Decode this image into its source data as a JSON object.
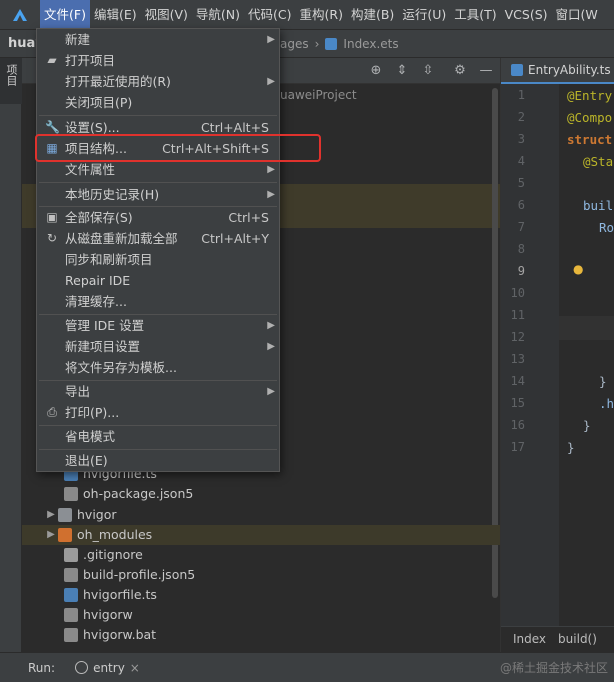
{
  "menubar": {
    "items": [
      "文件(F)",
      "编辑(E)",
      "视图(V)",
      "导航(N)",
      "代码(C)",
      "重构(R)",
      "构建(B)",
      "运行(U)",
      "工具(T)",
      "VCS(S)",
      "窗口(W"
    ]
  },
  "navbar": {
    "project": "huaw",
    "crumb_fragment": "ages",
    "crumb_file": "Index.ets"
  },
  "left_strip": {
    "project_label": "项目"
  },
  "project_panel": {
    "path_fragment": "uaweiProject",
    "tree": [
      {
        "label": "hvigorfile.ts",
        "icon": "ts-file-icon"
      },
      {
        "label": "oh-package.json5",
        "icon": "json-file-icon"
      },
      {
        "label": "hvigor",
        "icon": "folder-icon"
      },
      {
        "label": "oh_modules",
        "icon": "folder-orange-icon"
      },
      {
        "label": ".gitignore",
        "icon": "gitignore-icon"
      },
      {
        "label": "build-profile.json5",
        "icon": "json-file-icon"
      },
      {
        "label": "hvigorfile.ts",
        "icon": "ts-file-icon"
      },
      {
        "label": "hvigorw",
        "icon": "script-icon"
      },
      {
        "label": "hvigorw.bat",
        "icon": "bat-icon"
      }
    ]
  },
  "editor": {
    "tab_label": "EntryAbility.ts",
    "line_numbers": [
      "1",
      "2",
      "3",
      "4",
      "5",
      "6",
      "7",
      "8",
      "9",
      "10",
      "11",
      "12",
      "13",
      "14",
      "15",
      "16",
      "17"
    ],
    "code": {
      "l1": "@Entry",
      "l2": "@Compo",
      "l3": "struct",
      "l4": "@Sta",
      "l6": "buil",
      "l7": "Ro",
      "l14": "}",
      "l15": ".h",
      "l16": "}",
      "l17": "}"
    },
    "footer": [
      "Index",
      "build()"
    ]
  },
  "runbar": {
    "label": "Run:",
    "config": "entry",
    "close": "×"
  },
  "watermark": "@稀土掘金技术社区",
  "file_menu": {
    "items": [
      {
        "label": "新建",
        "shortcut": "",
        "submenu": true,
        "icon": ""
      },
      {
        "label": "打开项目",
        "shortcut": "",
        "submenu": false,
        "icon": "folder-open-icon"
      },
      {
        "label": "打开最近使用的(R)",
        "shortcut": "",
        "submenu": true,
        "icon": ""
      },
      {
        "label": "关闭项目(P)",
        "shortcut": "",
        "submenu": false,
        "icon": ""
      },
      {
        "label": "设置(S)...",
        "shortcut": "Ctrl+Alt+S",
        "submenu": false,
        "icon": "wrench-icon"
      },
      {
        "label": "项目结构...",
        "shortcut": "Ctrl+Alt+Shift+S",
        "submenu": false,
        "icon": "project-structure-icon"
      },
      {
        "label": "文件属性",
        "shortcut": "",
        "submenu": true,
        "icon": ""
      },
      {
        "label": "本地历史记录(H)",
        "shortcut": "",
        "submenu": true,
        "icon": ""
      },
      {
        "label": "全部保存(S)",
        "shortcut": "Ctrl+S",
        "submenu": false,
        "icon": "save-icon"
      },
      {
        "label": "从磁盘重新加载全部",
        "shortcut": "Ctrl+Alt+Y",
        "submenu": false,
        "icon": "reload-icon"
      },
      {
        "label": "同步和刷新项目",
        "shortcut": "",
        "submenu": false,
        "icon": ""
      },
      {
        "label": "Repair IDE",
        "shortcut": "",
        "submenu": false,
        "icon": ""
      },
      {
        "label": "清理缓存...",
        "shortcut": "",
        "submenu": false,
        "icon": ""
      },
      {
        "label": "管理 IDE 设置",
        "shortcut": "",
        "submenu": true,
        "icon": ""
      },
      {
        "label": "新建项目设置",
        "shortcut": "",
        "submenu": true,
        "icon": ""
      },
      {
        "label": "将文件另存为模板...",
        "shortcut": "",
        "submenu": false,
        "icon": ""
      },
      {
        "label": "导出",
        "shortcut": "",
        "submenu": true,
        "icon": ""
      },
      {
        "label": "打印(P)...",
        "shortcut": "",
        "submenu": false,
        "icon": "print-icon"
      },
      {
        "label": "省电模式",
        "shortcut": "",
        "submenu": false,
        "icon": ""
      },
      {
        "label": "退出(E)",
        "shortcut": "",
        "submenu": false,
        "icon": ""
      }
    ]
  },
  "colors": {
    "menu_active": "#4b6eaf",
    "highlight_box": "#e0322d",
    "annotation": "#bbb529",
    "keyword": "#cc7832"
  }
}
